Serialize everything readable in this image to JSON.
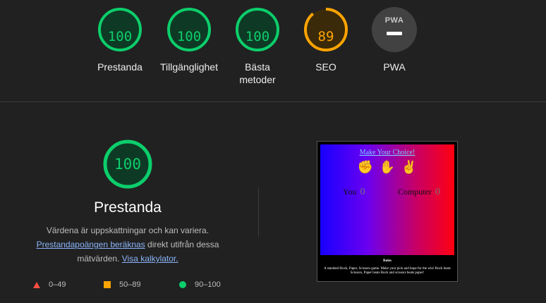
{
  "gauges": [
    {
      "score": "100",
      "label": "Prestanda",
      "fraction": 1.0,
      "color": "#0cce6b"
    },
    {
      "score": "100",
      "label": "Tillgänglighet",
      "fraction": 1.0,
      "color": "#0cce6b"
    },
    {
      "score": "100",
      "label": "Bästa metoder",
      "fraction": 1.0,
      "color": "#0cce6b"
    },
    {
      "score": "89",
      "label": "SEO",
      "fraction": 0.89,
      "color": "#ffa400"
    },
    {
      "badge": "PWA",
      "label": "PWA"
    }
  ],
  "performance": {
    "score": "100",
    "fraction": 1.0,
    "title": "Prestanda",
    "desc_part1": "Värdena är uppskattningar och kan variera.",
    "link1": "Prestandapoängen beräknas",
    "desc_part2": " direkt utifrån dessa mätvärden.",
    "link2": "Visa kalkylator."
  },
  "legend": [
    {
      "range": "0–49",
      "shape": "triangle",
      "color": "#ff4e42"
    },
    {
      "range": "50–89",
      "shape": "square",
      "color": "#ffa400"
    },
    {
      "range": "90–100",
      "shape": "circle",
      "color": "#0cce6b"
    }
  ],
  "screenshot": {
    "heading": "Make Your Choice!",
    "icons": [
      "fist-emoji",
      "hand-emoji",
      "victory-hand-emoji"
    ],
    "you_label": "You",
    "you_score": "0",
    "computer_label": "Computer",
    "computer_score": "0",
    "rules_title": "Rules",
    "rules_text": "A standard Rock, Paper, Scissors game. Make your pick and hope for the win! Rock beats Scissors, Paper beats Rock and scissors beats paper!"
  },
  "colors": {
    "pass": "#0cce6b",
    "average": "#ffa400",
    "fail": "#ff4e42",
    "background": "#212121"
  }
}
